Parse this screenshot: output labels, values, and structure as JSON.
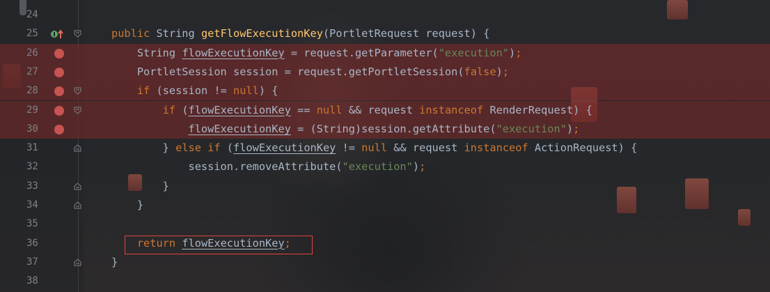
{
  "editor": {
    "lines": [
      {
        "num": "24",
        "breakpoint": false,
        "tokens": []
      },
      {
        "num": "25",
        "breakpoint": false,
        "override": true,
        "fold": "open",
        "tokens": [
          {
            "t": "kw",
            "v": "public "
          },
          {
            "t": "pl",
            "v": "String "
          },
          {
            "t": "fn",
            "v": "getFlowExecutionKey"
          },
          {
            "t": "pl",
            "v": "(PortletRequest request) {"
          }
        ]
      },
      {
        "num": "26",
        "breakpoint": true,
        "tokens": [
          {
            "t": "pl",
            "v": "    String "
          },
          {
            "t": "var",
            "v": "flowExecutionKey"
          },
          {
            "t": "pl",
            "v": " = request.getParameter("
          },
          {
            "t": "str",
            "v": "\"execution\""
          },
          {
            "t": "pl",
            "v": ")"
          },
          {
            "t": "kw",
            "v": ";"
          }
        ]
      },
      {
        "num": "27",
        "breakpoint": true,
        "tokens": [
          {
            "t": "pl",
            "v": "    PortletSession session = request.getPortletSession("
          },
          {
            "t": "kw",
            "v": "false"
          },
          {
            "t": "pl",
            "v": ")"
          },
          {
            "t": "kw",
            "v": ";"
          }
        ]
      },
      {
        "num": "28",
        "breakpoint": true,
        "fold": "open",
        "tokens": [
          {
            "t": "pl",
            "v": "    "
          },
          {
            "t": "kw",
            "v": "if "
          },
          {
            "t": "pl",
            "v": "(session != "
          },
          {
            "t": "kw",
            "v": "null"
          },
          {
            "t": "pl",
            "v": ") {"
          }
        ]
      },
      {
        "num": "29",
        "breakpoint": true,
        "fold": "open",
        "tokens": [
          {
            "t": "pl",
            "v": "        "
          },
          {
            "t": "kw",
            "v": "if "
          },
          {
            "t": "pl",
            "v": "("
          },
          {
            "t": "var",
            "v": "flowExecutionKey"
          },
          {
            "t": "pl",
            "v": " == "
          },
          {
            "t": "kw",
            "v": "null "
          },
          {
            "t": "pl",
            "v": "&& request "
          },
          {
            "t": "kw",
            "v": "instanceof "
          },
          {
            "t": "pl",
            "v": "RenderRequest) {"
          }
        ]
      },
      {
        "num": "30",
        "breakpoint": true,
        "tokens": [
          {
            "t": "pl",
            "v": "            "
          },
          {
            "t": "var",
            "v": "flowExecutionKey"
          },
          {
            "t": "pl",
            "v": " = (String)session.getAttribute("
          },
          {
            "t": "str",
            "v": "\"execution\""
          },
          {
            "t": "pl",
            "v": ")"
          },
          {
            "t": "kw",
            "v": ";"
          }
        ]
      },
      {
        "num": "31",
        "breakpoint": false,
        "fold": "close",
        "tokens": [
          {
            "t": "pl",
            "v": "        } "
          },
          {
            "t": "kw",
            "v": "else if "
          },
          {
            "t": "pl",
            "v": "("
          },
          {
            "t": "var",
            "v": "flowExecutionKey"
          },
          {
            "t": "pl",
            "v": " != "
          },
          {
            "t": "kw",
            "v": "null "
          },
          {
            "t": "pl",
            "v": "&& request "
          },
          {
            "t": "kw",
            "v": "instanceof "
          },
          {
            "t": "pl",
            "v": "ActionRequest) {"
          }
        ]
      },
      {
        "num": "32",
        "breakpoint": false,
        "tokens": [
          {
            "t": "pl",
            "v": "            session.removeAttribute("
          },
          {
            "t": "str",
            "v": "\"execution\""
          },
          {
            "t": "pl",
            "v": ")"
          },
          {
            "t": "kw",
            "v": ";"
          }
        ]
      },
      {
        "num": "33",
        "breakpoint": false,
        "fold": "close",
        "tokens": [
          {
            "t": "pl",
            "v": "        }"
          }
        ]
      },
      {
        "num": "34",
        "breakpoint": false,
        "fold": "close",
        "tokens": [
          {
            "t": "pl",
            "v": "    }"
          }
        ]
      },
      {
        "num": "35",
        "breakpoint": false,
        "tokens": []
      },
      {
        "num": "36",
        "breakpoint": false,
        "tokens": [
          {
            "t": "pl",
            "v": "    "
          },
          {
            "t": "kw",
            "v": "return "
          },
          {
            "t": "var",
            "v": "flowExecutionKey"
          },
          {
            "t": "kw",
            "v": ";"
          }
        ]
      },
      {
        "num": "37",
        "breakpoint": false,
        "fold": "close",
        "tokens": [
          {
            "t": "pl",
            "v": "}"
          }
        ]
      },
      {
        "num": "38",
        "breakpoint": false,
        "tokens": []
      }
    ]
  },
  "colors": {
    "keyword": "#cc7832",
    "method": "#ffc66d",
    "string": "#6a8759",
    "plain": "#a9b7c6",
    "breakpoint": "#c75450",
    "breakpoint_line": "#7c2a2a",
    "highlight_box": "#e0443e"
  },
  "icons": {
    "breakpoint": "breakpoint-icon",
    "override": "override-marker-icon",
    "fold": "fold-icon"
  }
}
